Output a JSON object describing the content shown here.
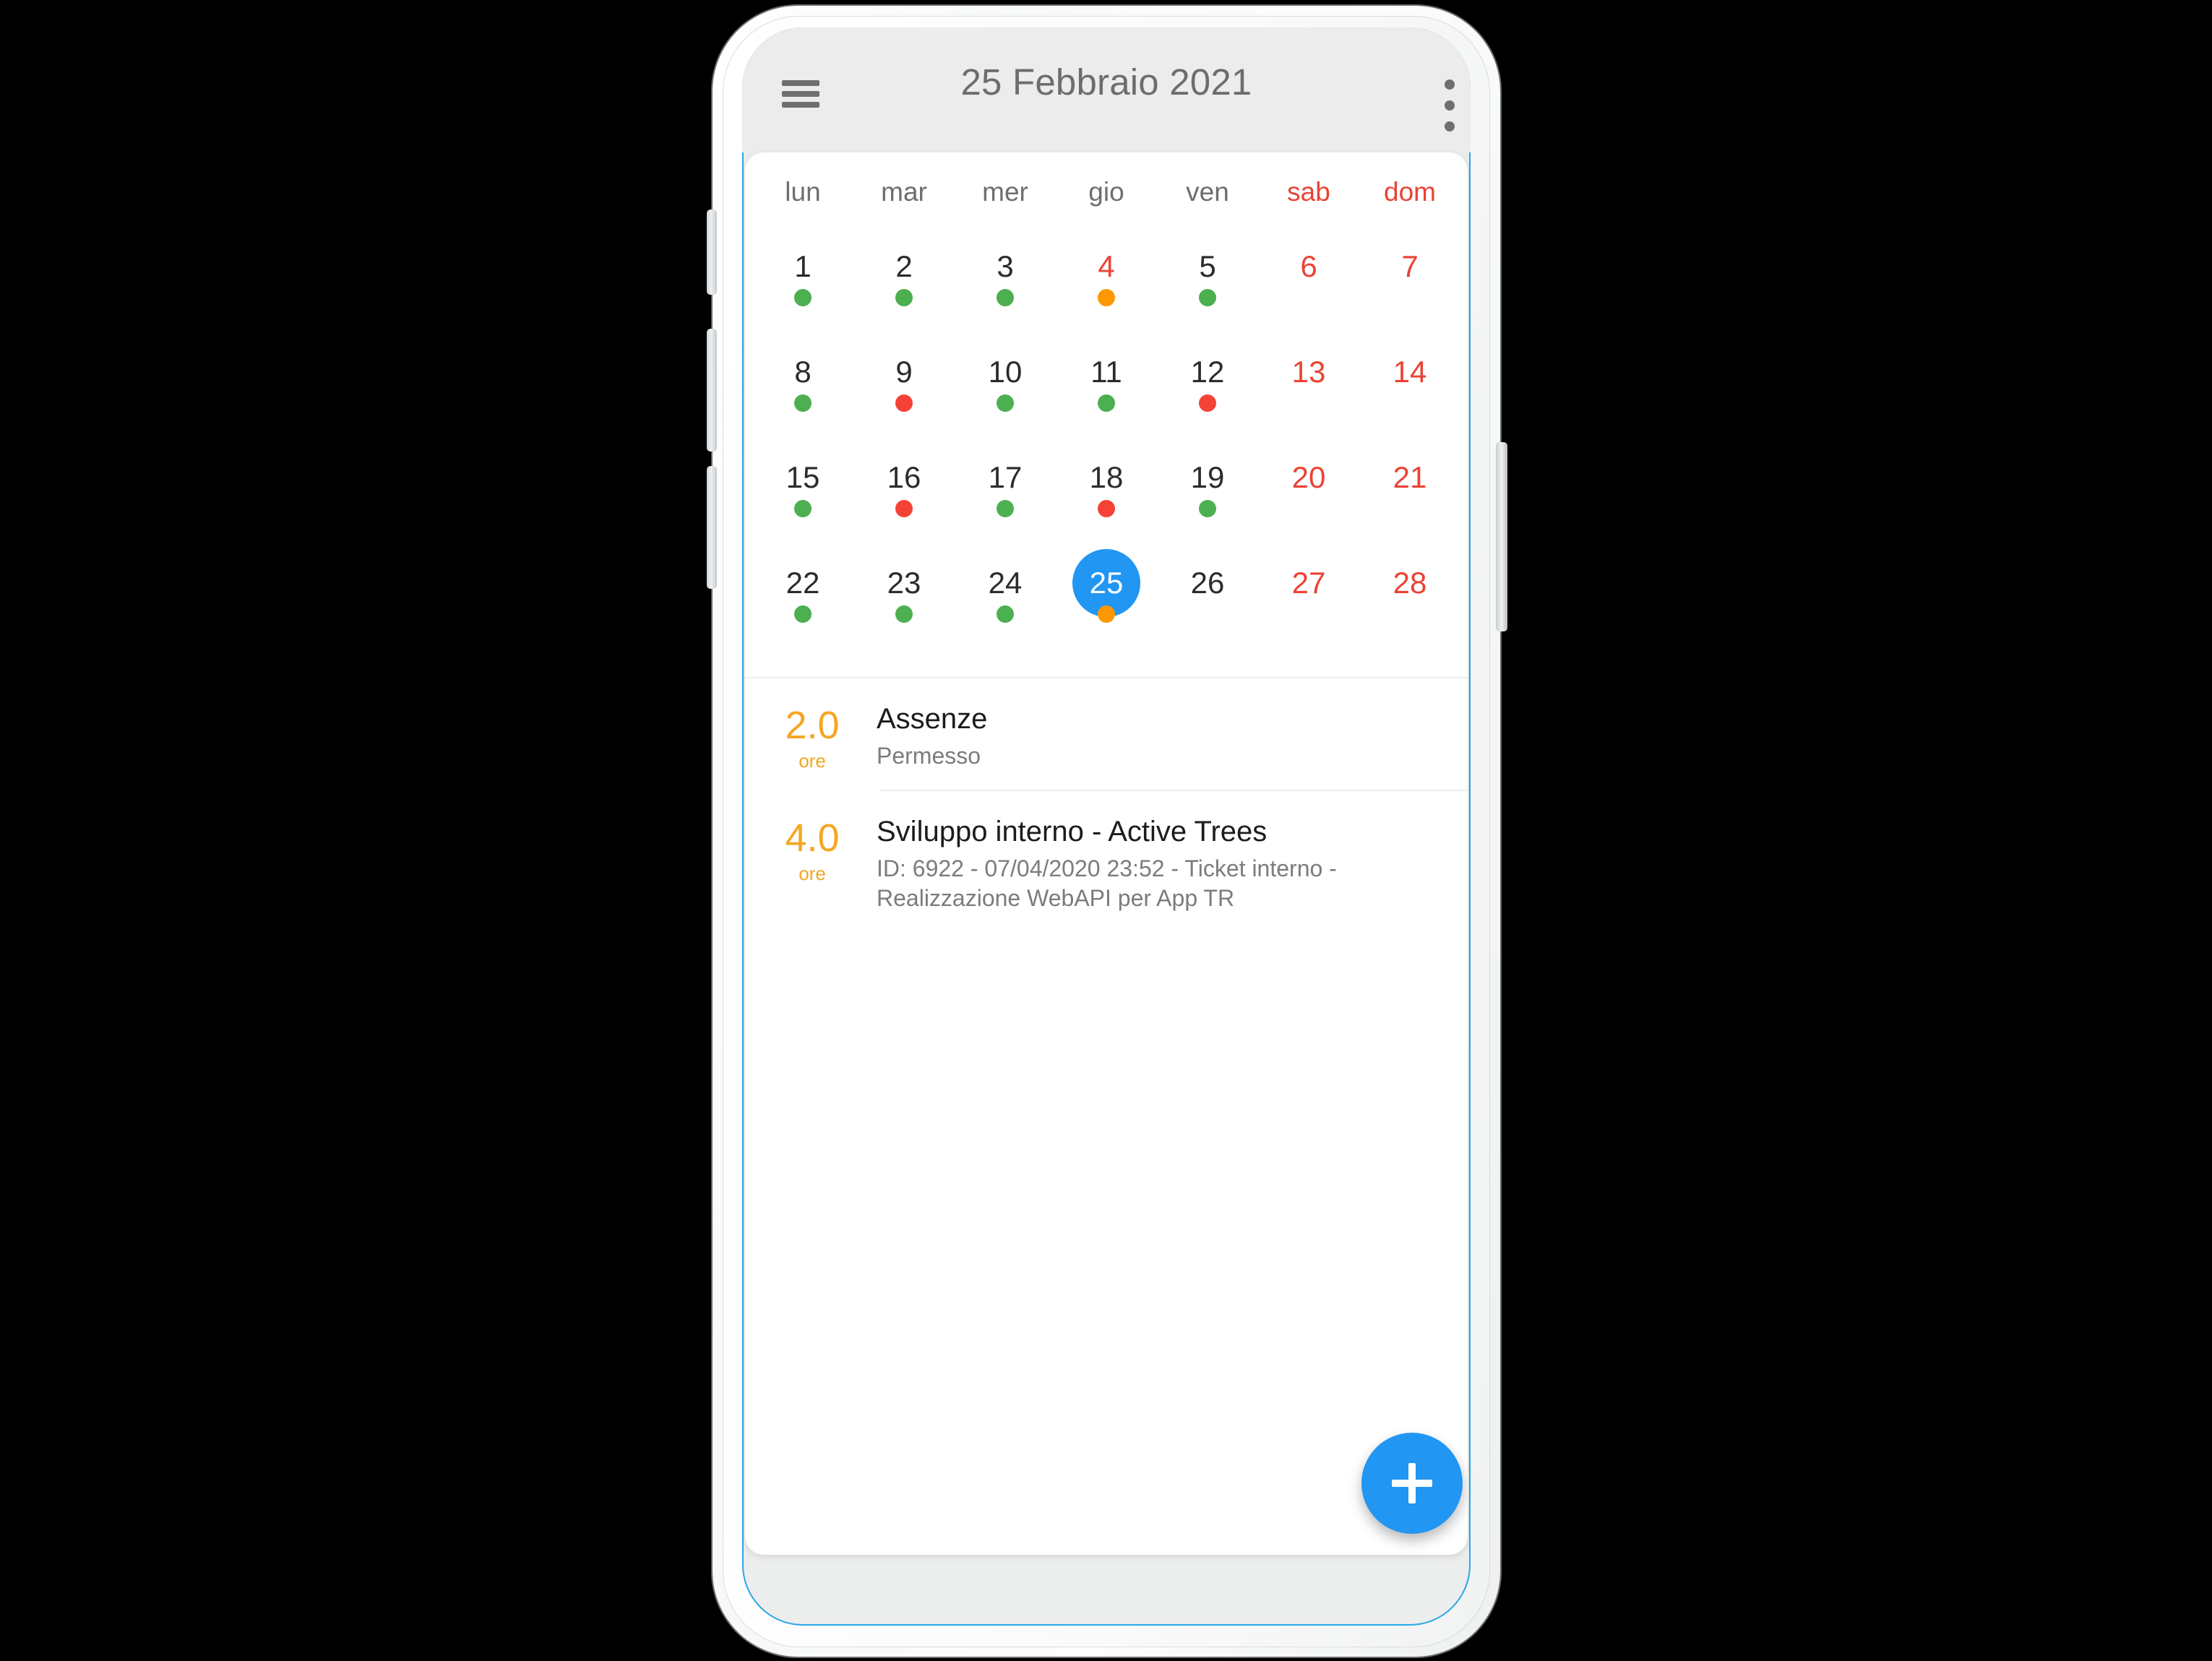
{
  "app": {
    "title": "25 Febbraio 2021",
    "menu_icon": "hamburger-icon",
    "overflow_icon": "overflow-menu-icon"
  },
  "colors": {
    "accent_blue": "#2196F3",
    "weekend_red": "#EA4335",
    "dot_green": "#4CAF50",
    "dot_red": "#F44336",
    "dot_orange": "#FF9800",
    "hours_orange": "#F5A623",
    "appbar_bg": "#ECECEC",
    "card_bg": "#FFFFFF"
  },
  "calendar": {
    "weekdays": [
      {
        "label": "lun",
        "weekend": false
      },
      {
        "label": "mar",
        "weekend": false
      },
      {
        "label": "mer",
        "weekend": false
      },
      {
        "label": "gio",
        "weekend": false
      },
      {
        "label": "ven",
        "weekend": false
      },
      {
        "label": "sab",
        "weekend": true
      },
      {
        "label": "dom",
        "weekend": true
      }
    ],
    "weeks": [
      [
        {
          "day": "1",
          "dot": "green",
          "weekend": false,
          "selected": false
        },
        {
          "day": "2",
          "dot": "green",
          "weekend": false,
          "selected": false
        },
        {
          "day": "3",
          "dot": "green",
          "weekend": false,
          "selected": false
        },
        {
          "day": "4",
          "dot": "orange",
          "weekend": true,
          "selected": false
        },
        {
          "day": "5",
          "dot": "green",
          "weekend": false,
          "selected": false
        },
        {
          "day": "6",
          "dot": "none",
          "weekend": true,
          "selected": false
        },
        {
          "day": "7",
          "dot": "none",
          "weekend": true,
          "selected": false
        }
      ],
      [
        {
          "day": "8",
          "dot": "green",
          "weekend": false,
          "selected": false
        },
        {
          "day": "9",
          "dot": "red",
          "weekend": false,
          "selected": false
        },
        {
          "day": "10",
          "dot": "green",
          "weekend": false,
          "selected": false
        },
        {
          "day": "11",
          "dot": "green",
          "weekend": false,
          "selected": false
        },
        {
          "day": "12",
          "dot": "red",
          "weekend": false,
          "selected": false
        },
        {
          "day": "13",
          "dot": "none",
          "weekend": true,
          "selected": false
        },
        {
          "day": "14",
          "dot": "none",
          "weekend": true,
          "selected": false
        }
      ],
      [
        {
          "day": "15",
          "dot": "green",
          "weekend": false,
          "selected": false
        },
        {
          "day": "16",
          "dot": "red",
          "weekend": false,
          "selected": false
        },
        {
          "day": "17",
          "dot": "green",
          "weekend": false,
          "selected": false
        },
        {
          "day": "18",
          "dot": "red",
          "weekend": false,
          "selected": false
        },
        {
          "day": "19",
          "dot": "green",
          "weekend": false,
          "selected": false
        },
        {
          "day": "20",
          "dot": "none",
          "weekend": true,
          "selected": false
        },
        {
          "day": "21",
          "dot": "none",
          "weekend": true,
          "selected": false
        }
      ],
      [
        {
          "day": "22",
          "dot": "green",
          "weekend": false,
          "selected": false
        },
        {
          "day": "23",
          "dot": "green",
          "weekend": false,
          "selected": false
        },
        {
          "day": "24",
          "dot": "green",
          "weekend": false,
          "selected": false
        },
        {
          "day": "25",
          "dot": "orange",
          "weekend": false,
          "selected": true
        },
        {
          "day": "26",
          "dot": "none",
          "weekend": false,
          "selected": false
        },
        {
          "day": "27",
          "dot": "none",
          "weekend": true,
          "selected": false
        },
        {
          "day": "28",
          "dot": "none",
          "weekend": true,
          "selected": false
        }
      ]
    ]
  },
  "entries": [
    {
      "hours": "2.0",
      "unit": "ore",
      "title": "Assenze",
      "subtitle": "Permesso"
    },
    {
      "hours": "4.0",
      "unit": "ore",
      "title": "Sviluppo interno - Active Trees",
      "subtitle": "ID: 6922 - 07/04/2020 23:52 - Ticket interno - Realizzazione WebAPI per App TR"
    }
  ],
  "fab": {
    "label": "+",
    "icon": "plus-icon"
  }
}
